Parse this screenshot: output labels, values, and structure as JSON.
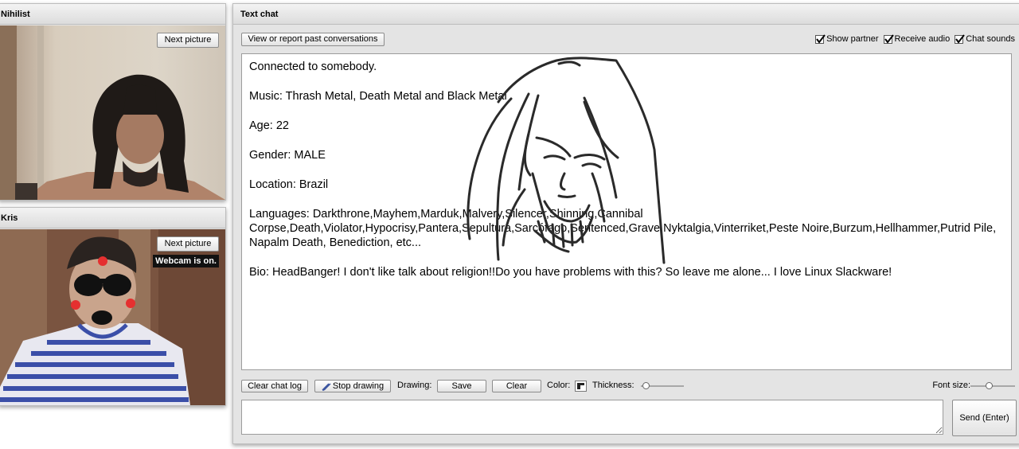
{
  "partner_panel": {
    "title": "Nihilist",
    "next_picture_label": "Next picture"
  },
  "self_panel": {
    "title": "Kris",
    "next_picture_label": "Next picture",
    "webcam_status": "Webcam is on."
  },
  "chat_panel": {
    "title": "Text chat",
    "past_conversations_label": "View or report past conversations",
    "options": [
      {
        "label": "Show partner",
        "checked": true
      },
      {
        "label": "Receive audio",
        "checked": true
      },
      {
        "label": "Chat sounds",
        "checked": true
      }
    ],
    "log_lines": [
      "Connected to somebody.",
      "Music: Thrash Metal, Death Metal and Black Metal",
      "Age: 22",
      "Gender: MALE",
      "Location: Brazil",
      "Languages: Darkthrone,Mayhem,Marduk,Malvery,Silencer,Shinning,Cannibal Corpse,Death,Violator,Hypocrisy,Pantera,Sepultura,Sarcófago,Sentenced,Grave,Nyktalgia,Vinterriket,Peste Noire,Burzum,Hellhammer,Putrid Pile, Napalm Death, Benediction, etc...",
      "Bio: HeadBanger! I don't like talk about religion!!Do you have problems with this? So leave me alone... I love Linux Slackware!"
    ],
    "toolbar": {
      "clear_log_label": "Clear chat log",
      "stop_drawing_label": "Stop drawing",
      "drawing_label": "Drawing:",
      "save_label": "Save",
      "clear_label": "Clear",
      "color_label": "Color:",
      "thickness_label": "Thickness:",
      "thickness_value": 0.05,
      "font_size_label": "Font size:",
      "font_size_value": 0.4
    },
    "message_input_value": "",
    "send_label": "Send (Enter)"
  },
  "icons": {
    "pencil": "pencil-icon",
    "color_swatch": "color-swatch-icon",
    "checkmark": "checkmark-icon"
  }
}
